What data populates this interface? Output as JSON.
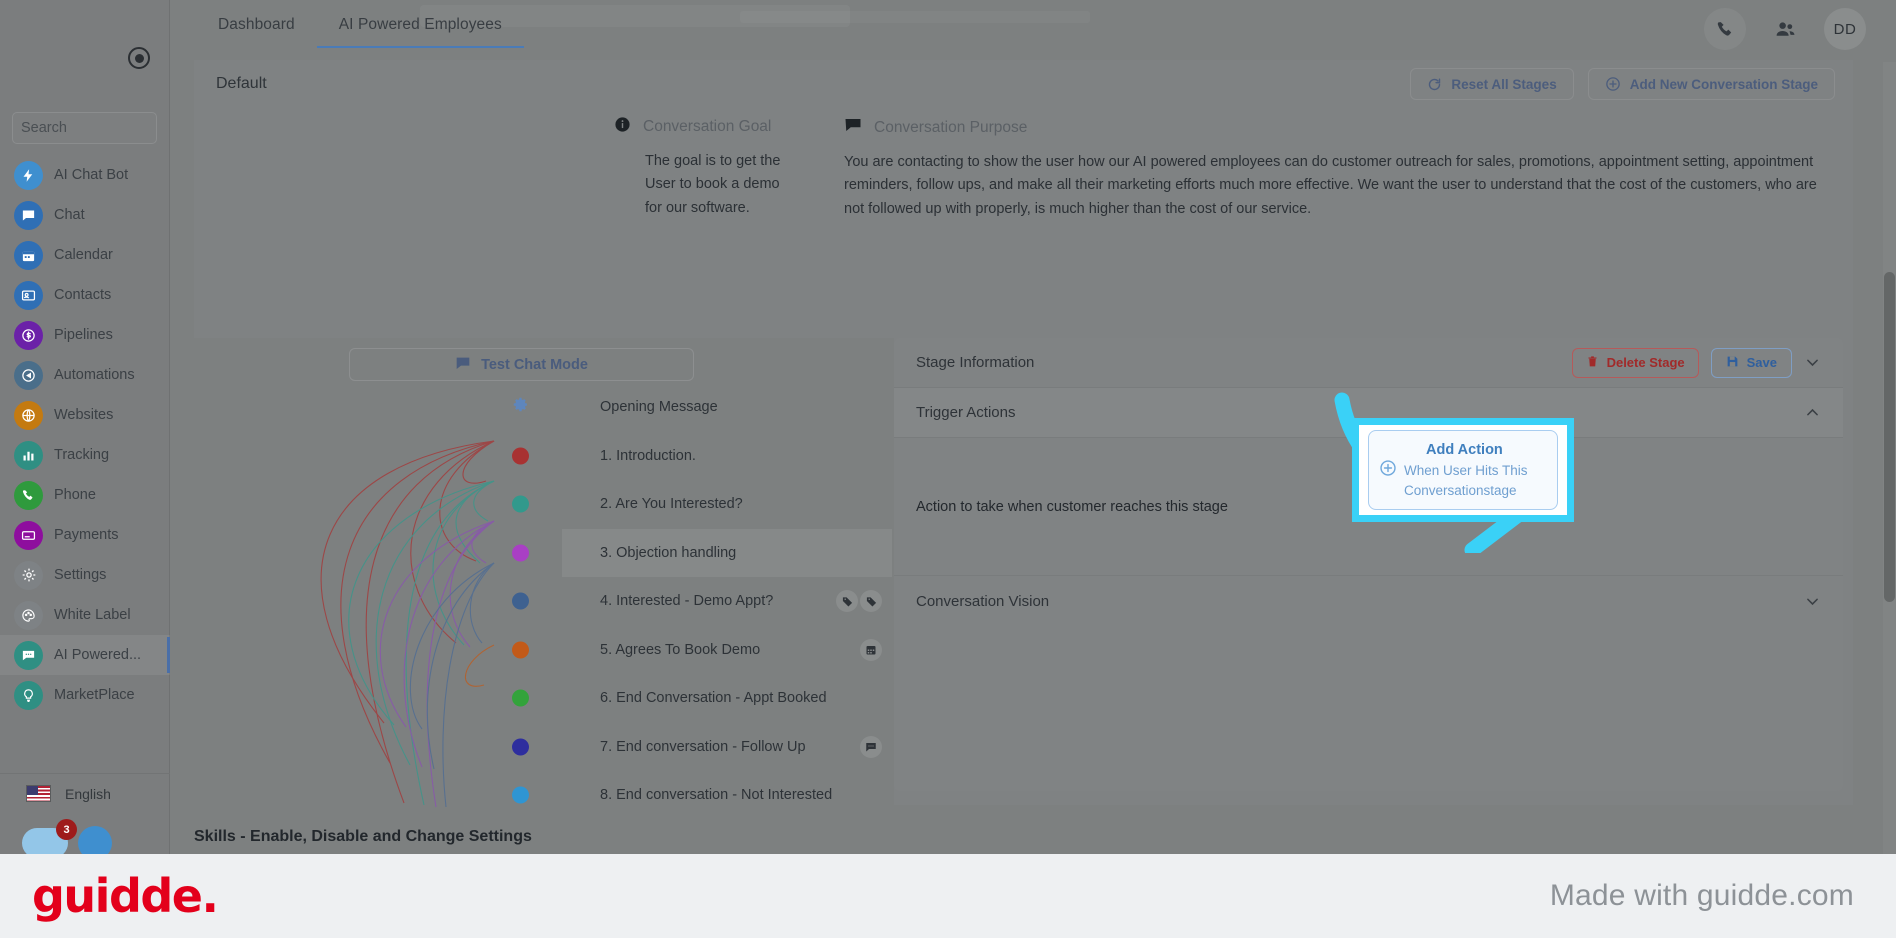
{
  "sidebar": {
    "logo_icon": "record-dot-icon",
    "search": {
      "placeholder": "Search",
      "value": "",
      "icon": "search-icon"
    },
    "items": [
      {
        "label": "AI Chat Bot",
        "icon": "bolt-icon",
        "color": "#3f8fcf",
        "active": false
      },
      {
        "label": "Chat",
        "icon": "chat-bubble-icon",
        "color": "#2f6fb5",
        "active": false
      },
      {
        "label": "Calendar",
        "icon": "calendar-icon",
        "color": "#2f6fb5",
        "active": false
      },
      {
        "label": "Contacts",
        "icon": "contact-card-icon",
        "color": "#2f6fb5",
        "active": false
      },
      {
        "label": "Pipelines",
        "icon": "dollar-icon",
        "color": "#6b21a8",
        "active": false
      },
      {
        "label": "Automations",
        "icon": "automation-icon",
        "color": "#4a6e8a",
        "active": false
      },
      {
        "label": "Websites",
        "icon": "globe-icon",
        "color": "#c47a10",
        "active": false
      },
      {
        "label": "Tracking",
        "icon": "bar-chart-icon",
        "color": "#2f8f83",
        "active": false
      },
      {
        "label": "Phone",
        "icon": "phone-icon",
        "color": "#2f9a3d",
        "active": false
      },
      {
        "label": "Payments",
        "icon": "credit-card-icon",
        "color": "#8e0e9e",
        "active": false
      },
      {
        "label": "Settings",
        "icon": "gear-icon",
        "color": "#7e8285",
        "active": false
      },
      {
        "label": "White Label",
        "icon": "palette-icon",
        "color": "#7e8285",
        "active": false
      },
      {
        "label": "AI Powered...",
        "icon": "ai-chat-icon",
        "color": "#2f8f83",
        "active": true
      },
      {
        "label": "MarketPlace",
        "icon": "bulb-icon",
        "color": "#2f8f83",
        "active": false
      }
    ],
    "language": {
      "label": "English",
      "flag": "us-flag-icon"
    },
    "badge_count": "3"
  },
  "topbar": {
    "tabs": [
      {
        "label": "Dashboard",
        "active": false
      },
      {
        "label": "AI Powered Employees",
        "active": true
      }
    ],
    "phone_icon": "phone-icon",
    "people_icon": "people-icon",
    "avatar_initials": "DD"
  },
  "card": {
    "title": "Default",
    "reset_button": {
      "label": "Reset All Stages",
      "icon": "refresh-icon"
    },
    "add_stage_button": {
      "label": "Add New Conversation Stage",
      "icon": "plus-circle-icon"
    }
  },
  "goal": {
    "icon": "info-icon",
    "label": "Conversation Goal",
    "text": "The goal is to get the User to book a demo for our software."
  },
  "purpose": {
    "icon": "comment-icon",
    "label": "Conversation Purpose",
    "text": "You are contacting to show the user how our AI powered employees can do customer outreach for sales, promotions, appointment setting, appointment reminders, follow ups, and make all their marketing efforts much more effective. We want the user to understand that the cost of the customers, who are not followed up with properly, is much higher than the cost of our service."
  },
  "test_chat": {
    "label": "Test Chat Mode",
    "icon": "chat-icon"
  },
  "stages": [
    {
      "name": "Opening Message",
      "dot": null,
      "gear": true,
      "selected": false,
      "icons": []
    },
    {
      "name": "1. Introduction.",
      "dot": "#a83232",
      "gear": false,
      "selected": false,
      "icons": []
    },
    {
      "name": "2. Are You Interested?",
      "dot": "#32998c",
      "gear": false,
      "selected": false,
      "icons": []
    },
    {
      "name": "3. Objection handling",
      "dot": "#a93fc4",
      "gear": false,
      "selected": true,
      "icons": []
    },
    {
      "name": "4. Interested - Demo Appt?",
      "dot": "#3e6190",
      "gear": false,
      "selected": false,
      "icons": [
        "tag-icon",
        "tag-icon"
      ]
    },
    {
      "name": "5. Agrees To Book Demo",
      "dot": "#c25a19",
      "gear": false,
      "selected": false,
      "icons": [
        "calendar-icon"
      ]
    },
    {
      "name": "6. End Conversation - Appt Booked",
      "dot": "#33a33b",
      "gear": false,
      "selected": false,
      "icons": []
    },
    {
      "name": "7. End conversation - Follow Up",
      "dot": "#2e2e9e",
      "gear": false,
      "selected": false,
      "icons": [
        "chat-dots-icon"
      ]
    },
    {
      "name": "8. End conversation - Not Interested",
      "dot": "#2f95d3",
      "gear": false,
      "selected": false,
      "icons": []
    }
  ],
  "panel": {
    "stage_information": {
      "title": "Stage Information",
      "delete_label": "Delete Stage",
      "delete_icon": "trash-icon",
      "save_label": "Save",
      "save_icon": "save-icon",
      "chevron": "chevron-down-icon"
    },
    "trigger_actions": {
      "title": "Trigger Actions",
      "chevron": "chevron-up-icon",
      "description": "Action to take when customer reaches this stage"
    },
    "conversation_vision": {
      "title": "Conversation Vision",
      "chevron": "chevron-down-icon"
    }
  },
  "add_action": {
    "title": "Add Action",
    "subtitle": "When User Hits This Conversationstage",
    "icon": "plus-circle-icon",
    "highlight_color": "#3ad1f7"
  },
  "arrow": {
    "color": "#3ad1f7",
    "name": "curved-arrow-annotation"
  },
  "skills_heading": "Skills - Enable, Disable and Change Settings",
  "footer": {
    "logo_text": "guidde.",
    "tagline": "Made with guidde.com",
    "logo_color": "#e3001b"
  }
}
